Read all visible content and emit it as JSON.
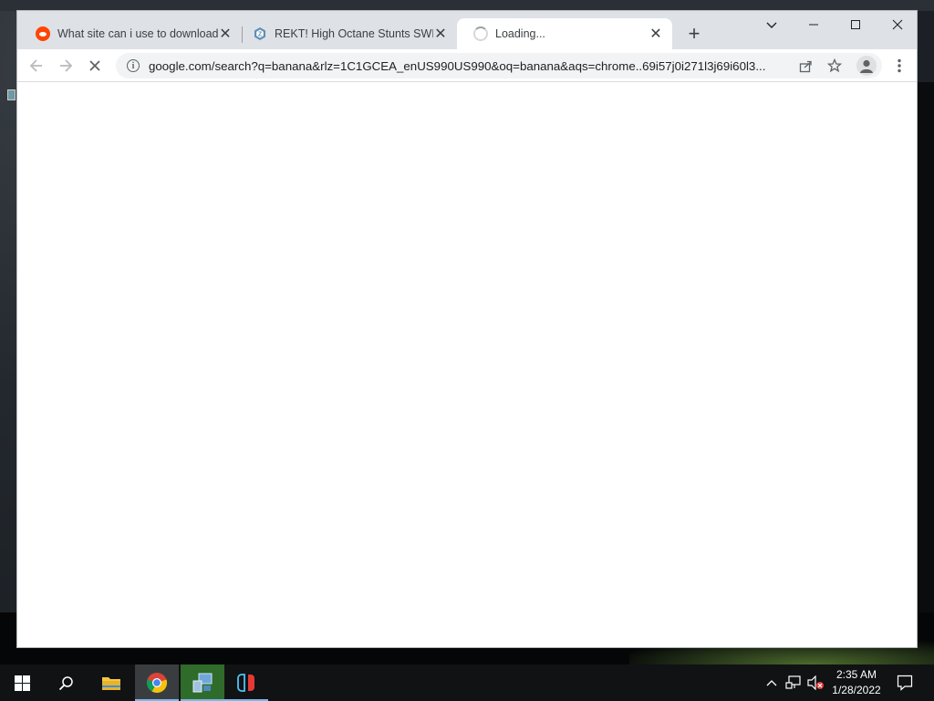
{
  "browser": {
    "tabs": [
      {
        "title": "What site can i use to download",
        "favicon": "reddit-icon"
      },
      {
        "title": "REKT! High Octane Stunts SWITC",
        "favicon": "hexagon-site-icon"
      },
      {
        "title": "Loading...",
        "favicon": "loading-spinner-icon",
        "active": true
      }
    ],
    "new_tab_label": "+",
    "address": "google.com/search?q=banana&rlz=1C1GCEA_enUS990US990&oq=banana&aqs=chrome..69i57j0i271l3j69i60l3...",
    "accent": "#1a73e8"
  },
  "taskbar": {
    "apps": [
      "windows-start-icon",
      "search-icon",
      "file-explorer-icon",
      "chrome-icon",
      "control-panel-icon",
      "nintendo-switch-icon"
    ],
    "clock_time": "2:35 AM",
    "clock_date": "1/28/2022"
  }
}
